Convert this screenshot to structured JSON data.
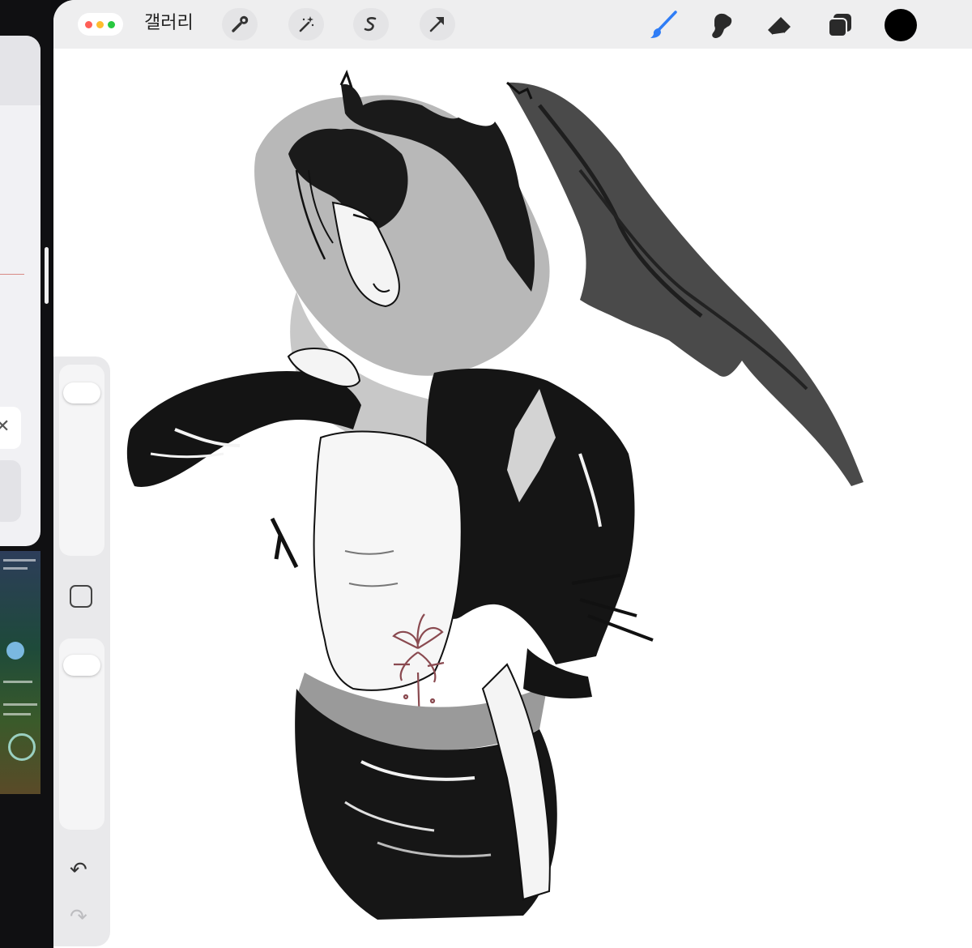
{
  "app": {
    "gallery_label": "갤러리"
  },
  "colors": {
    "active_tool": "#2f7df6",
    "current_color": "#000000",
    "tattoo": "#8a4a50",
    "traffic": [
      "#ff5f57",
      "#febc2e",
      "#28c840"
    ]
  },
  "toolbar_left": {
    "icons": [
      "wrench-icon",
      "magic-wand-icon",
      "selection-s-icon",
      "transform-arrow-icon"
    ]
  },
  "toolbar_right": {
    "icons": [
      "brush-icon",
      "smudge-icon",
      "eraser-icon",
      "layers-icon",
      "color-swatch-icon"
    ],
    "active": "brush-icon"
  },
  "sidebar": {
    "brush_size_level": 0.92,
    "opacity_level": 0.93,
    "undo_icon": "undo-icon",
    "redo_icon": "redo-icon",
    "modifier_icon": "modifier-square-icon"
  }
}
